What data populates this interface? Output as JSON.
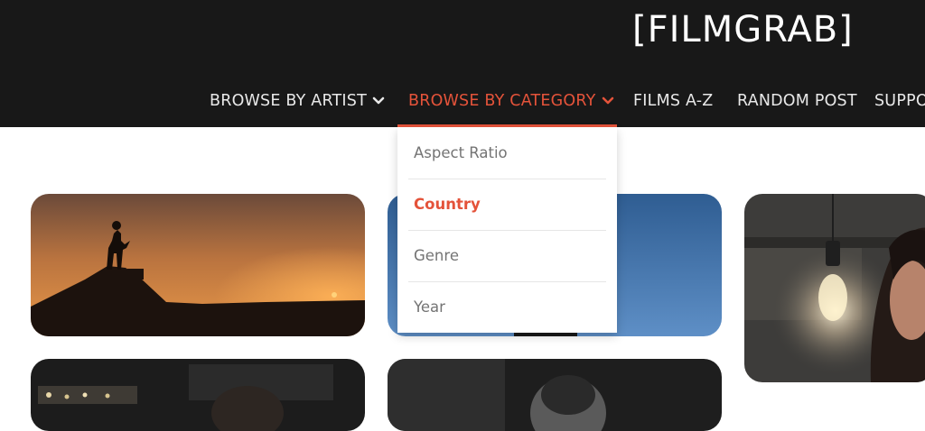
{
  "site": {
    "logo": "[FILMGRAB]"
  },
  "nav": {
    "items": [
      {
        "label": "BROWSE BY ARTIST",
        "has_dropdown": true,
        "active": false
      },
      {
        "label": "BROWSE BY CATEGORY",
        "has_dropdown": true,
        "active": true
      },
      {
        "label": "FILMS A-Z",
        "has_dropdown": false,
        "active": false
      },
      {
        "label": "RANDOM POST",
        "has_dropdown": false,
        "active": false
      },
      {
        "label": "SUPPO",
        "has_dropdown": false,
        "active": false
      }
    ]
  },
  "dropdown": {
    "items": [
      {
        "label": "Aspect Ratio",
        "active": false
      },
      {
        "label": "Country",
        "active": true
      },
      {
        "label": "Genre",
        "active": false
      },
      {
        "label": "Year",
        "active": false
      }
    ]
  },
  "colors": {
    "header_bg": "#181818",
    "accent": "#e4533a",
    "nav_text": "#e8e8e8",
    "dropdown_text": "#747474"
  },
  "icons": {
    "dropdown_indicator": "chevron-down-icon"
  }
}
